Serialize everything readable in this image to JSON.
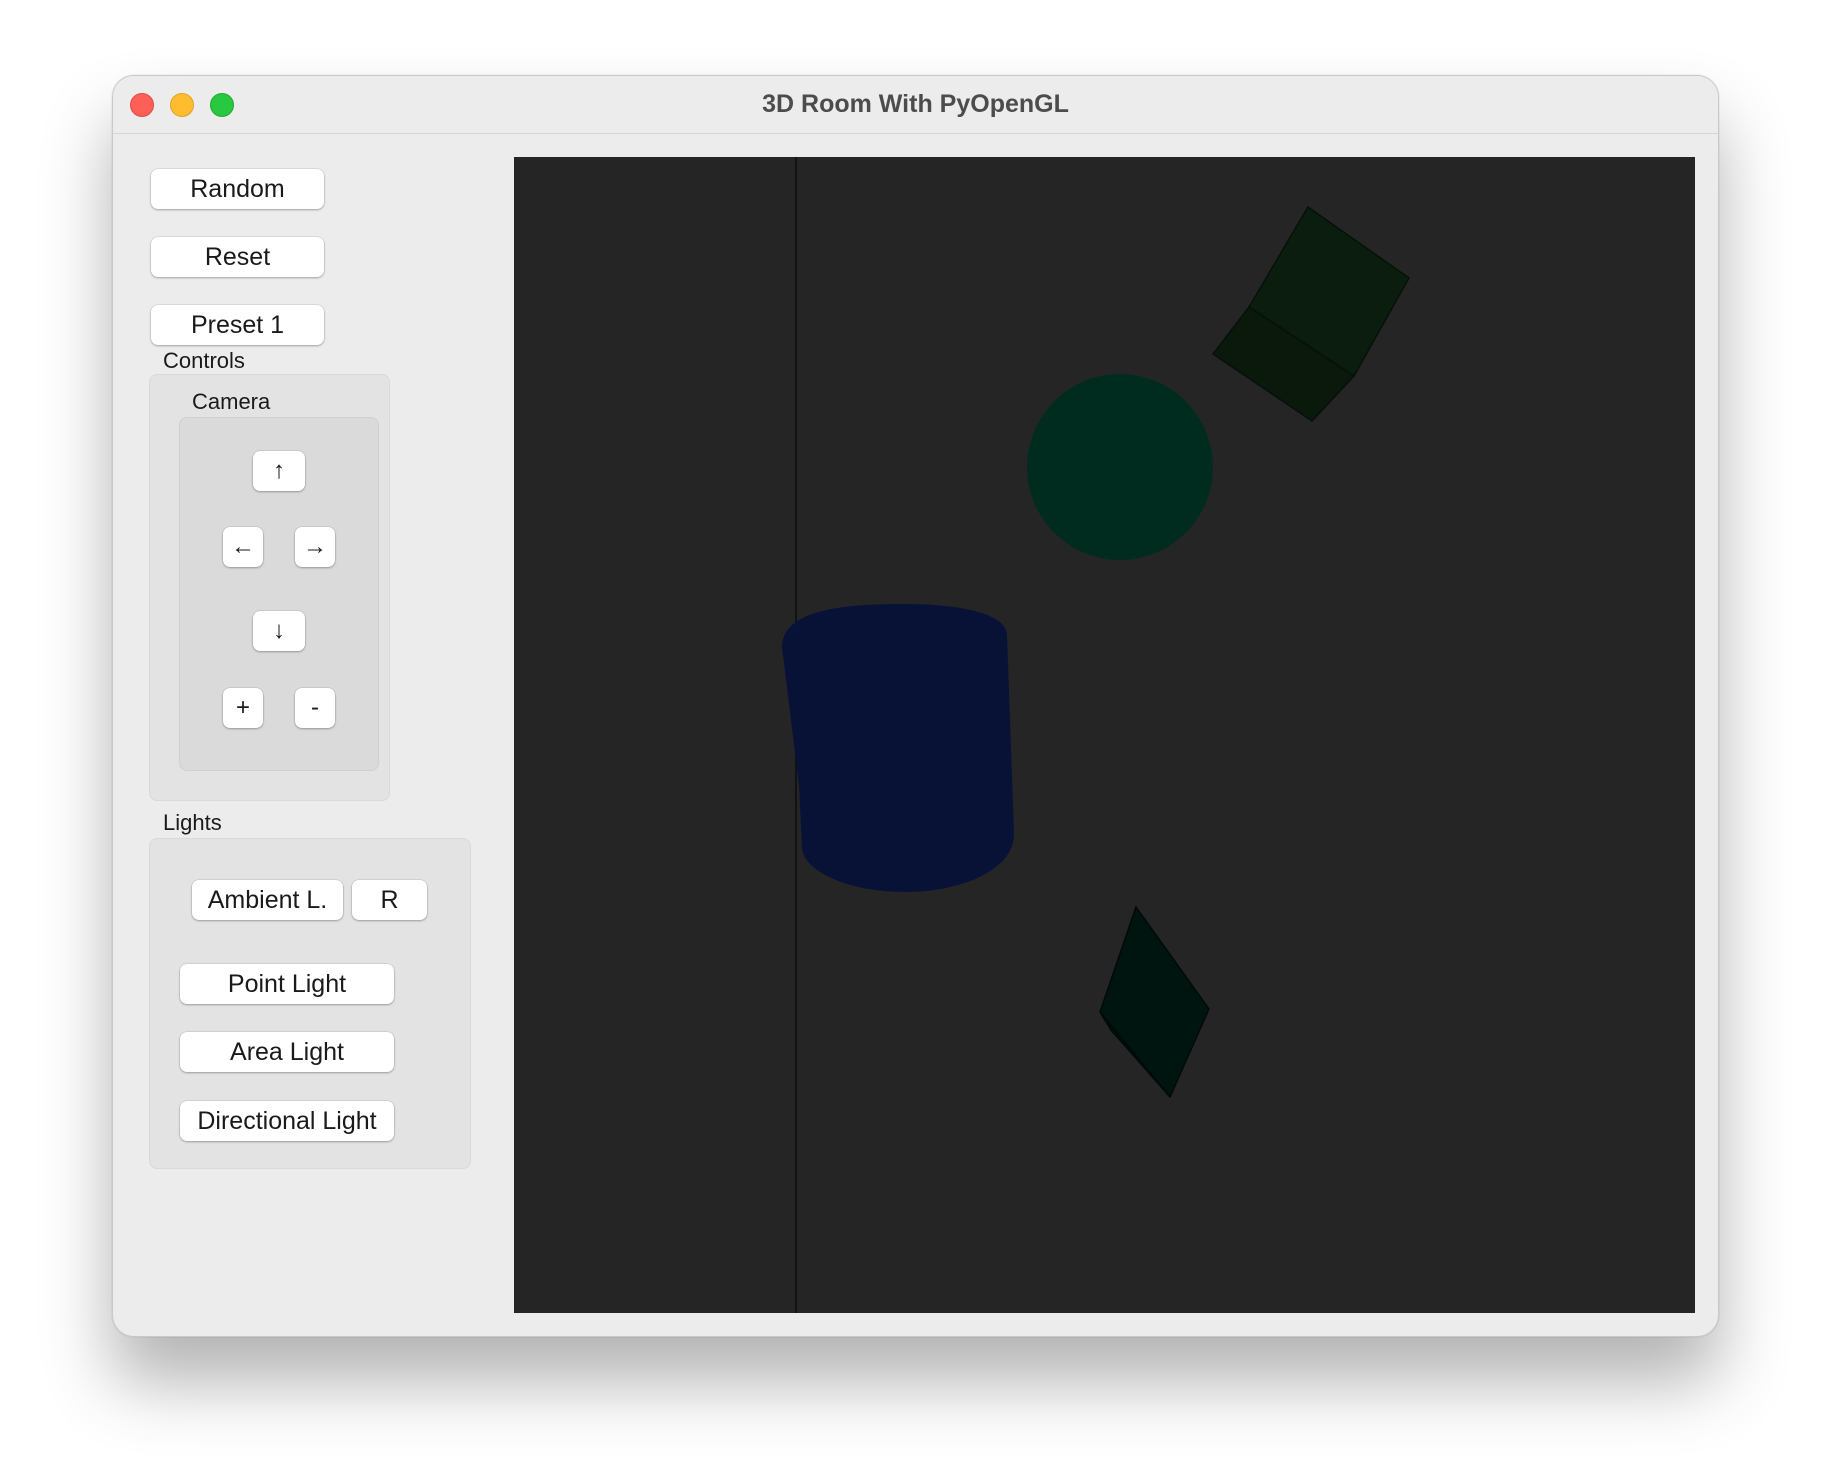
{
  "window": {
    "title": "3D Room With PyOpenGL"
  },
  "sidebar": {
    "random_label": "Random",
    "reset_label": "Reset",
    "preset_label": "Preset 1",
    "controls_label": "Controls",
    "camera": {
      "label": "Camera",
      "up": "↑",
      "left": "←",
      "right": "→",
      "down": "↓",
      "zoom_in": "+",
      "zoom_out": "-"
    },
    "lights": {
      "label": "Lights",
      "ambient_label": "Ambient L.",
      "ambient_reset_label": "R",
      "point_label": "Point Light",
      "area_label": "Area Light",
      "directional_label": "Directional Light"
    }
  },
  "scene": {
    "background_color": "#252525",
    "cube_color": "#0b1d0e",
    "sphere_color": "#002c20",
    "cylinder_color": "#081236",
    "tetrahedron_color": "#001510"
  }
}
